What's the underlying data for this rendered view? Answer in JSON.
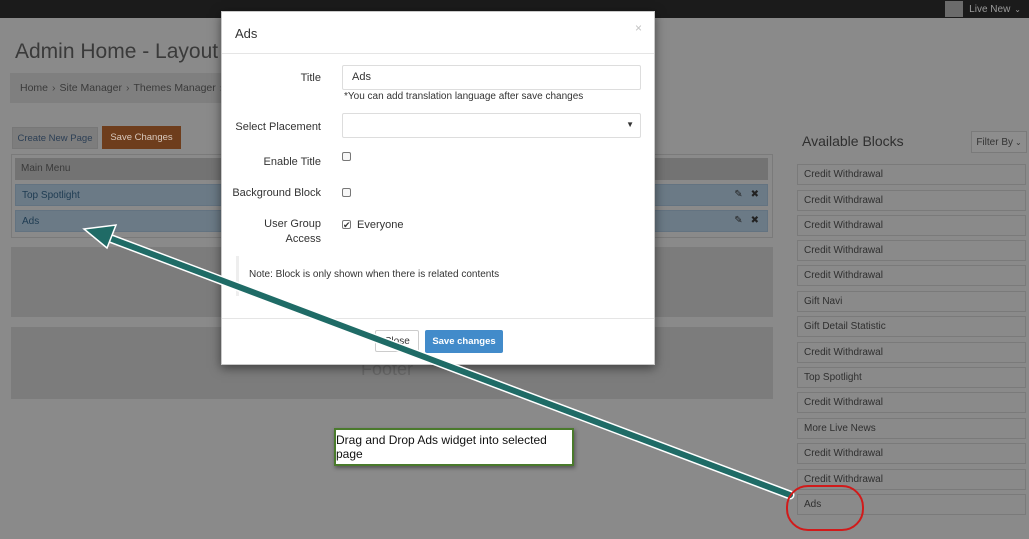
{
  "topbar": {
    "user_label": "Live New"
  },
  "page": {
    "title": "Admin Home - Layout E"
  },
  "breadcrumb": [
    "Home",
    "Site Manager",
    "Themes Manager"
  ],
  "toolbar": {
    "create_label": "Create New Page",
    "save_label": "Save Changes"
  },
  "menu": {
    "header": "Main Menu",
    "rows": [
      {
        "label": "Top Spotlight"
      },
      {
        "label": "Ads"
      }
    ],
    "footer_label": "Footer"
  },
  "available_blocks": {
    "title": "Available Blocks",
    "filter_label": "Filter By",
    "items": [
      "Credit Withdrawal",
      "Credit Withdrawal",
      "Credit Withdrawal",
      "Credit Withdrawal",
      "Credit Withdrawal",
      "Gift Navi",
      "Gift Detail Statistic",
      "Credit Withdrawal",
      "Top Spotlight",
      "Credit Withdrawal",
      "More Live News",
      "Credit Withdrawal",
      "Credit Withdrawal",
      "Ads"
    ]
  },
  "modal": {
    "title": "Ads",
    "close_glyph": "×",
    "title_label": "Title",
    "title_value": "Ads",
    "title_hint": "*You can add translation language after save changes",
    "placement_label": "Select Placement",
    "placement_value": "",
    "enable_title_label": "Enable Title",
    "background_block_label": "Background Block",
    "user_group_label_1": "User Group",
    "user_group_label_2": "Access",
    "everyone_label": "Everyone",
    "note": "Note: Block is only shown when there is related contents",
    "close_button": "Close",
    "save_button": "Save changes"
  },
  "annotation": {
    "callout_text": "Drag and Drop Ads widget into selected page",
    "arrow_color": "#1f6b66",
    "ring_color": "#d11a1a"
  }
}
